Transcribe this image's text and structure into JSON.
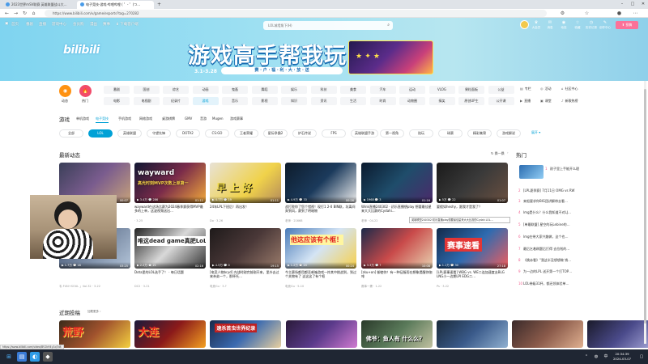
{
  "browser": {
    "tabs": [
      {
        "label": "2023世界mSV联赛 英雄联盟战斗大…",
        "active": false
      },
      {
        "label": "电子竞技-游戏-哔哩哔哩 ( ゜- ゜)つ…",
        "active": true
      }
    ],
    "new_tab": "+",
    "url": "https://www.bilibili.com/v/game/esports?tag=270282",
    "status_url": "https://www.bilibili.com/video/BV1kH4y1q7d8"
  },
  "topnav": {
    "items": [
      "首页",
      "番剧",
      "直播",
      "游戏中心",
      "会员购",
      "漫画",
      "赛事",
      "下载客户端"
    ],
    "search_placeholder": "LOL城墙角下(H)",
    "right": [
      {
        "icon": "crown-icon",
        "label": "大会员"
      },
      {
        "icon": "message-icon",
        "label": "消息"
      },
      {
        "icon": "dynamic-icon",
        "label": "动态"
      },
      {
        "icon": "star-icon",
        "label": "收藏"
      },
      {
        "icon": "history-icon",
        "label": "历史记录"
      },
      {
        "icon": "creator-icon",
        "label": "创作中心"
      }
    ],
    "upload_label": "投稿"
  },
  "banner": {
    "logo": "bilibili",
    "title": "游戏高手帮我玩",
    "date": "3.1-3.28",
    "pill": "赛 · 户 · 福 · 利 · 大 · 放 · 送",
    "accent": "#00a1d6",
    "pink": "#fb7299"
  },
  "quick": [
    {
      "icon": "dynamic-circle-icon",
      "label": "动态",
      "color": "#ff9212"
    },
    {
      "icon": "hot-circle-icon",
      "label": "热门",
      "color": "#f24b6a"
    }
  ],
  "categories": {
    "row1": [
      "番剧",
      "国创",
      "综艺",
      "动画",
      "鬼畜",
      "舞蹈",
      "娱乐",
      "科技",
      "美食",
      "汽车",
      "运动",
      "VLOG",
      "果粒面板",
      "公益"
    ],
    "row2": [
      "电影",
      "电视剧",
      "纪录片",
      "游戏",
      "音乐",
      "影视",
      "知识",
      "资讯",
      "生活",
      "时尚",
      "动物圈",
      "搞笑",
      "原创UP主",
      "公开课"
    ],
    "selected": "游戏"
  },
  "side_cats": [
    {
      "icon": "column-icon",
      "label": "专栏"
    },
    {
      "icon": "activity-icon",
      "label": "活动"
    },
    {
      "icon": "community-icon",
      "label": "社区中心"
    },
    {
      "icon": "live-icon",
      "label": "直播"
    },
    {
      "icon": "class-icon",
      "label": "课堂"
    },
    {
      "icon": "new-song-icon",
      "label": "新歌热榜"
    }
  ],
  "zone": {
    "title": "游戏",
    "tabs": [
      "单机游戏",
      "电子竞技",
      "手机游戏",
      "网络游戏",
      "桌游棋牌",
      "GMV",
      "音游",
      "Mugen",
      "游戏赛事"
    ],
    "selected": "电子竞技"
  },
  "tags": {
    "items": [
      "全部",
      "LOL",
      "英雄联盟",
      "守望先锋",
      "DOTA2",
      "CS:GO",
      "王者荣耀",
      "星际争霸2",
      "炉石传说",
      "FPS",
      "英雄联盟手游",
      "第一视角",
      "陪玩",
      "球赛",
      "精彩集锦",
      "游戏解说"
    ],
    "selected": "LOL",
    "more": "展开 ▾"
  },
  "recent": {
    "title": "最新动态",
    "refresh": "换一换",
    "row1": [
      {
        "stat": "▶ 1.2万  💬 3",
        "dur": "00:07",
        "overlay": "",
        "title": "",
        "up": ""
      },
      {
        "stat": "▶ 3.4万  💬 286",
        "dur": "01:11",
        "overlay": "wayward",
        "overlay2": "高光时刻MVP次数上单第一",
        "title": "wayward在这场比赛为2024春季赛获得MVP最多的上单，这波视频送出…",
        "up": "·  3-25"
      },
      {
        "stat": "▶ 4.7万  💬 19",
        "dur": "01:11",
        "overlay": "早 上 好",
        "title": "24年LPL下班后！再出发！",
        "up": "Do · 3-26"
      },
      {
        "stat": "▶ 4.9万  💬 33",
        "dur": "00:26",
        "overlay": "",
        "title": "战打败你了您个错视！现打1 2-0 BIN联，坑离间奔到风，赛到了明暗物",
        "up": "老师 · 21668"
      },
      {
        "stat": "▶ 1968  💬 3",
        "dur": "01:16",
        "overlay": "",
        "title": "Wink直播240302 · 初乐直播想play 想要最佳星来大大比赛的Cydahi…",
        "up": "老师 · 04-22"
      },
      {
        "stat": "▶ 5万  💬 22",
        "dur": "01:07",
        "overlay": "",
        "title": "要假如heshy，跟我才是我了？",
        "up": "头 · 3-27"
      }
    ],
    "row2": [
      {
        "stat": "▶ 1.7万  💬 18",
        "dur": "03:25",
        "overlay": "",
        "title": "",
        "up": "韦 FUN+SOUL 」Vol.32 · 3-22"
      },
      {
        "stat": "▶ 2.2万  💬 21",
        "dur": "02:16",
        "overlay": "唯这dead game真肥LoL惹",
        "title": "Dota里的LOL选手了！ · 每日话题",
        "up": "DC2 · 3-21"
      },
      {
        "stat": "▶ 4.5万  💬 0",
        "dur": "19:15",
        "overlay": "",
        "title": "[电竞人物bryd] 内战时刚完前刚开来，里外去过来亲弟一个，那杯托…",
        "up": "电竞Gu · 3-?"
      },
      {
        "stat": "▶ 1.2万  💬 24",
        "dur": "00:24",
        "overlay": "他这应该有个框！",
        "title": "今主赛场都用都丢邮箱游戏一炸其中挑战到，到过个关物有了 这这这了有个框",
        "up": "电竞Gu · 5-10"
      },
      {
        "stat": "▶ 3.3万  💬 ?",
        "dur": "10:08",
        "overlay": "",
        "title": "[zku+on] 御使你！有一种征服而在想象提醒你咖啡",
        "up": "赛事一妻 · 1-22"
      },
      {
        "stat": "▶ 1.1万  💬 30",
        "dur": "27:18",
        "overlay": "赛事速看",
        "title": "[LPL赛事速看] WBG vs. WE二连加速度去BLG LNG小一边期LPI EDG二…",
        "up": "Ps · 3-22"
      }
    ]
  },
  "hot": {
    "title": "热门",
    "items": [
      {
        "rank": "1",
        "title": "耐子里上手能开么理"
      },
      {
        "rank": "2",
        "title": "[LPL夏季赛] 7月11日 OMG vs RW"
      },
      {
        "rank": "3",
        "title": "来船要求你BIG团讲解带去看…"
      },
      {
        "rank": "4",
        "title": "lmg是什么？什么我知道不对LJ…"
      },
      {
        "rank": "5",
        "title": "[单最联盟] 星空的玩Lebine的…"
      },
      {
        "rank": "6",
        "title": "lmg在带大家兴趣做，这个也…"
      },
      {
        "rank": "7",
        "title": "最后乞着刷题后打得 去拉啦的…"
      },
      {
        "rank": "8",
        "title": "《跳赤看》\"我这半没想想做 销…"
      },
      {
        "rank": "9",
        "title": "为一边的LPL 送开第一个打TOP…"
      },
      {
        "rank": "10",
        "title": "LOL带级31杯，都还领体验单…"
      }
    ]
  },
  "recent_posts": {
    "title": "近期投稿",
    "more": "加载更多 ›",
    "overlays": [
      "荒野",
      "大连",
      "速杀首虫世界纪录",
      "",
      "佛爷：鱼人有 什么么？",
      "",
      "",
      ""
    ]
  },
  "tooltip": "英雄联盟240302·初乐直播play想要最佳星来大大比赛的Cydah LOL...",
  "taskbar": {
    "time": "20:34:39",
    "date": "2024-03-07",
    "lang": "中"
  }
}
